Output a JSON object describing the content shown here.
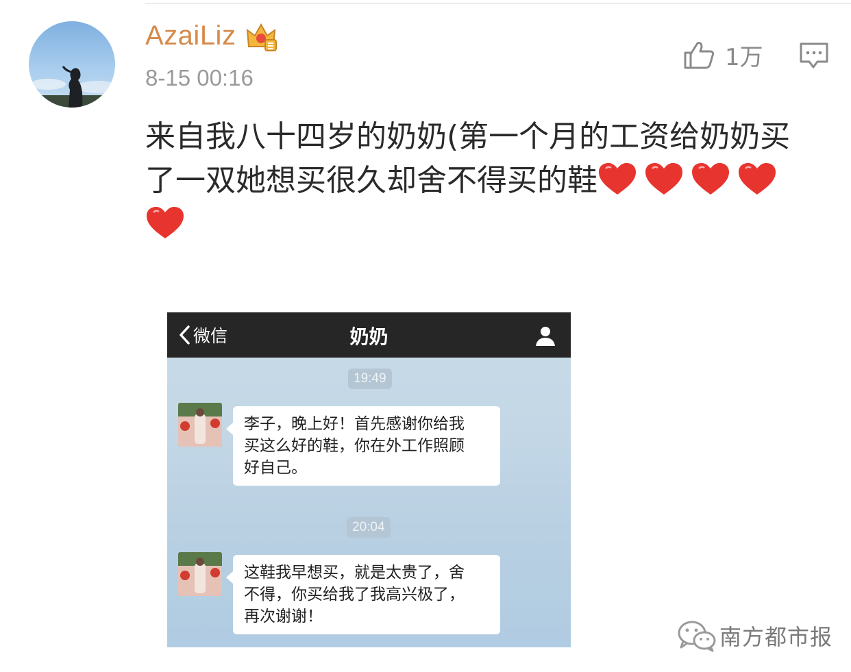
{
  "post": {
    "username": "AzaiLiz",
    "timestamp": "8-15 00:16",
    "like_count": "1万",
    "text_line1": "来自我八十四岁的奶奶(第一个月的工资给奶奶买",
    "text_line2": "了一双她想买很久却舍不得买的鞋",
    "heart_count": 5
  },
  "chat": {
    "back_label": "微信",
    "title": "奶奶",
    "messages": [
      {
        "time": "19:49",
        "lines": [
          "李子，晚上好！首先感谢你给我",
          "买这么好的鞋，你在外工作照顾",
          "好自己。"
        ]
      },
      {
        "time": "20:04",
        "lines": [
          "这鞋我早想买，就是太贵了，舍",
          "不得，你买给我了我高兴极了，",
          "再次谢谢！"
        ]
      }
    ]
  },
  "watermark": {
    "text": "南方都市报"
  },
  "colors": {
    "username": "#d68a4a",
    "timestamp": "#9a9a9a",
    "heart": "#e8342e",
    "chat_header": "#262626",
    "chat_background": "#c3d7e6"
  },
  "icons": [
    "crown-badge-icon",
    "thumbs-up-icon",
    "comment-icon",
    "heart-icon",
    "chevron-left-icon",
    "person-icon",
    "wechat-icon"
  ]
}
